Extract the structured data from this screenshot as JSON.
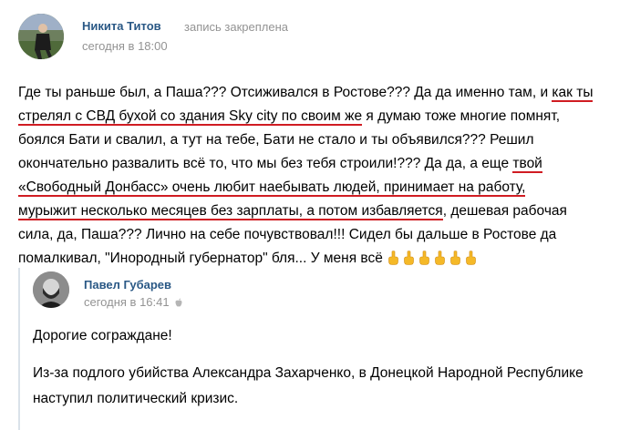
{
  "post": {
    "author": "Никита Титов",
    "pinned": "запись закреплена",
    "time": "сегодня в 18:00",
    "lines": [
      [
        "Где ты раньше был, а Паша??? Отсиживался в Ростове??? Да да именно там, и ",
        "как ты",
        ""
      ],
      [
        "",
        "стрелял с СВД бухой со здания Sky city по своим же",
        " я думаю тоже многие помнят,"
      ],
      [
        "боялся Бати и свалил, а тут на тебе, Бати не стало и ты объявился??? Решил",
        "",
        ""
      ],
      [
        "окончательно развалить всё то, что мы без тебя строили!??? Да да, а еще ",
        "твой",
        ""
      ],
      [
        "",
        "«Свободный Донбасс» очень любит наебывать людей, принимает на работу,",
        ""
      ],
      [
        "",
        "мурыжит несколько месяцев без зарплаты, а потом избавляется",
        ", дешевая рабочая"
      ],
      [
        "сила, да, Паша??? Лично на себе почувствовал!!! Сидел бы дальше в Ростове да",
        "",
        ""
      ],
      [
        "помалкивал, \"Инородный губернатор\" бля... У меня всё",
        "",
        ""
      ]
    ],
    "emoji": [
      "middle-finger",
      "middle-finger",
      "middle-finger",
      "middle-finger",
      "middle-finger",
      "middle-finger"
    ],
    "emoji_color": "#f5b928"
  },
  "repost": {
    "author": "Павел Губарев",
    "time": "сегодня в 16:41",
    "device_icon": "apple-icon",
    "paragraph1": "Дорогие сограждане!",
    "paragraph2_line1": "Из-за подлого убийства Александра Захарченко, в Донецкой Народной Республике",
    "paragraph2_line2": "наступил политический кризис."
  },
  "colors": {
    "link": "#2a5885",
    "meta": "#939393",
    "underline": "#d01c22",
    "quote_bar": "#dae2ea"
  }
}
